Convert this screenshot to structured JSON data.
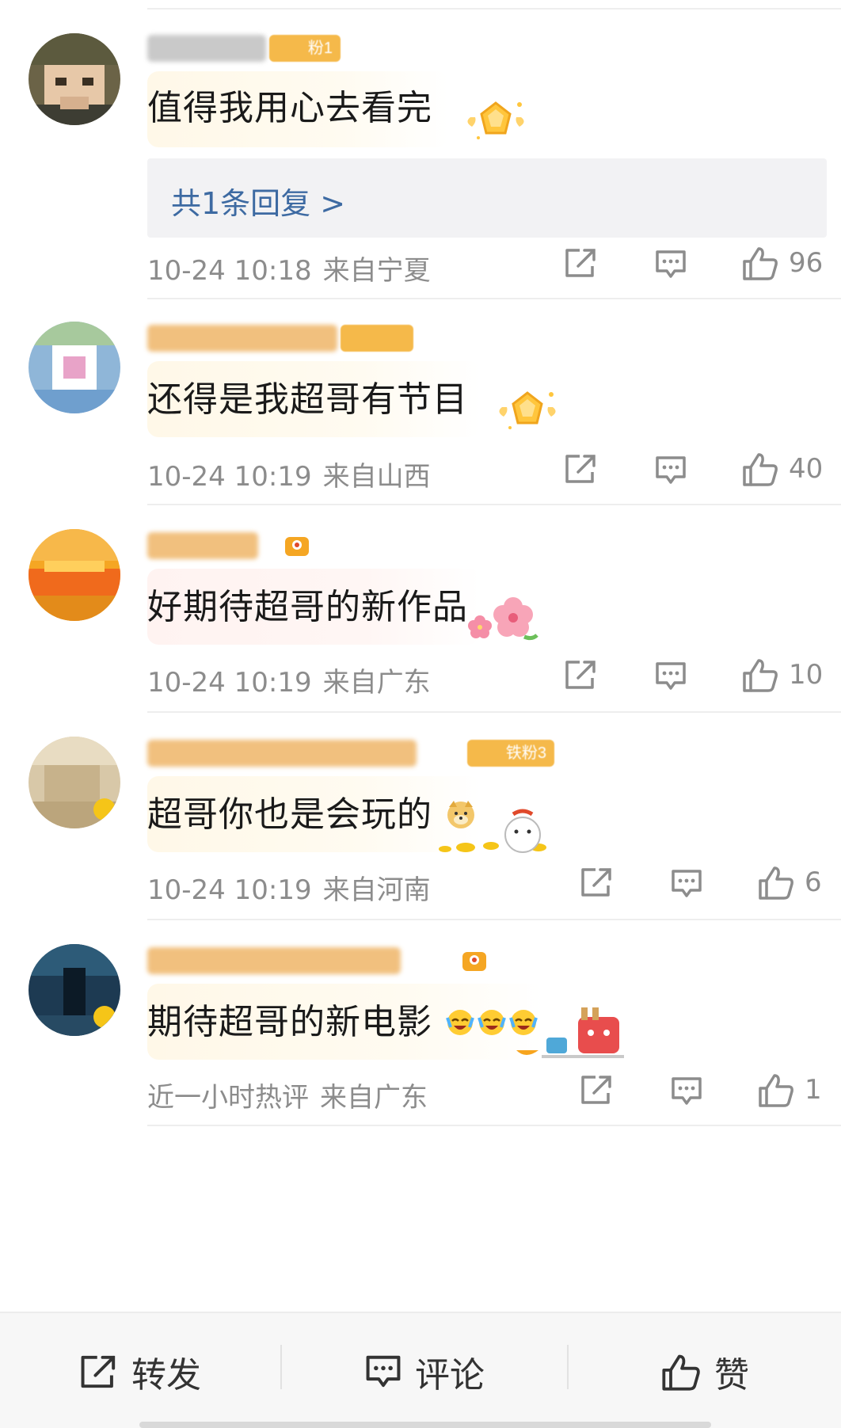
{
  "comments": [
    {
      "text": "值得我用心去看完",
      "badge": "粉1",
      "reply": "共1条回复 >",
      "time": "10-24 10:18",
      "location": "来自宁夏",
      "likes": "96"
    },
    {
      "text": "还得是我超哥有节目",
      "badge": "",
      "time": "10-24 10:19",
      "location": "来自山西",
      "likes": "40"
    },
    {
      "text": "好期待超哥的新作品",
      "time": "10-24 10:19",
      "location": "来自广东",
      "likes": "10"
    },
    {
      "text": "超哥你也是会玩的",
      "badge": "铁粉3",
      "time": "10-24 10:19",
      "location": "来自河南",
      "likes": "6"
    },
    {
      "text": "期待超哥的新电影",
      "time": "近一小时热评",
      "location": "来自广东",
      "likes": "1"
    }
  ],
  "icons": {
    "repost": "repost-icon",
    "comment": "comment-icon",
    "like": "thumbs-up-icon"
  },
  "bottom_bar": {
    "repost_label": "转发",
    "comment_label": "评论",
    "like_label": "赞"
  },
  "colors": {
    "reply_link": "#3d6aa2",
    "meta_text": "#8c8c8c",
    "badge_orange": "#f5b94a"
  }
}
